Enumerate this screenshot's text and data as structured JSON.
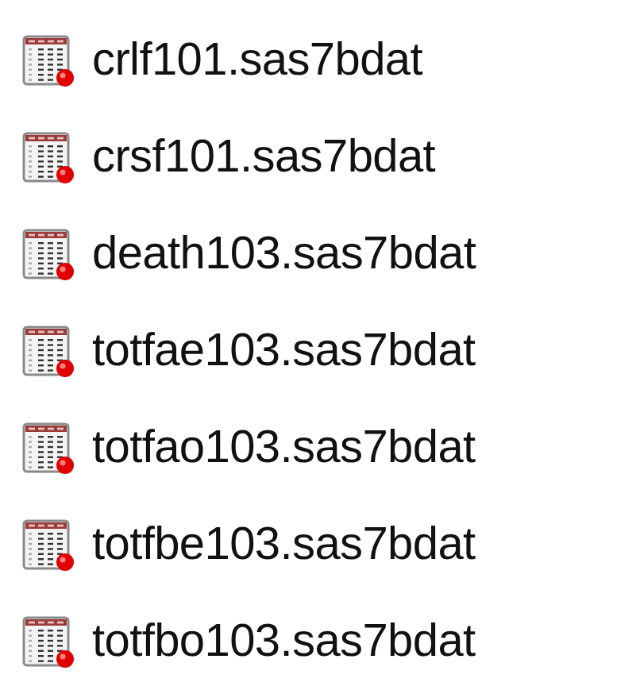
{
  "files": [
    {
      "name": "crlf101.sas7bdat",
      "selected": false
    },
    {
      "name": "crsf101.sas7bdat",
      "selected": false
    },
    {
      "name": "death103.sas7bdat",
      "selected": false
    },
    {
      "name": "totfae103.sas7bdat",
      "selected": false
    },
    {
      "name": "totfao103.sas7bdat",
      "selected": false
    },
    {
      "name": "totfbe103.sas7bdat",
      "selected": false
    },
    {
      "name": "totfbo103.sas7bdat",
      "selected": false
    }
  ]
}
